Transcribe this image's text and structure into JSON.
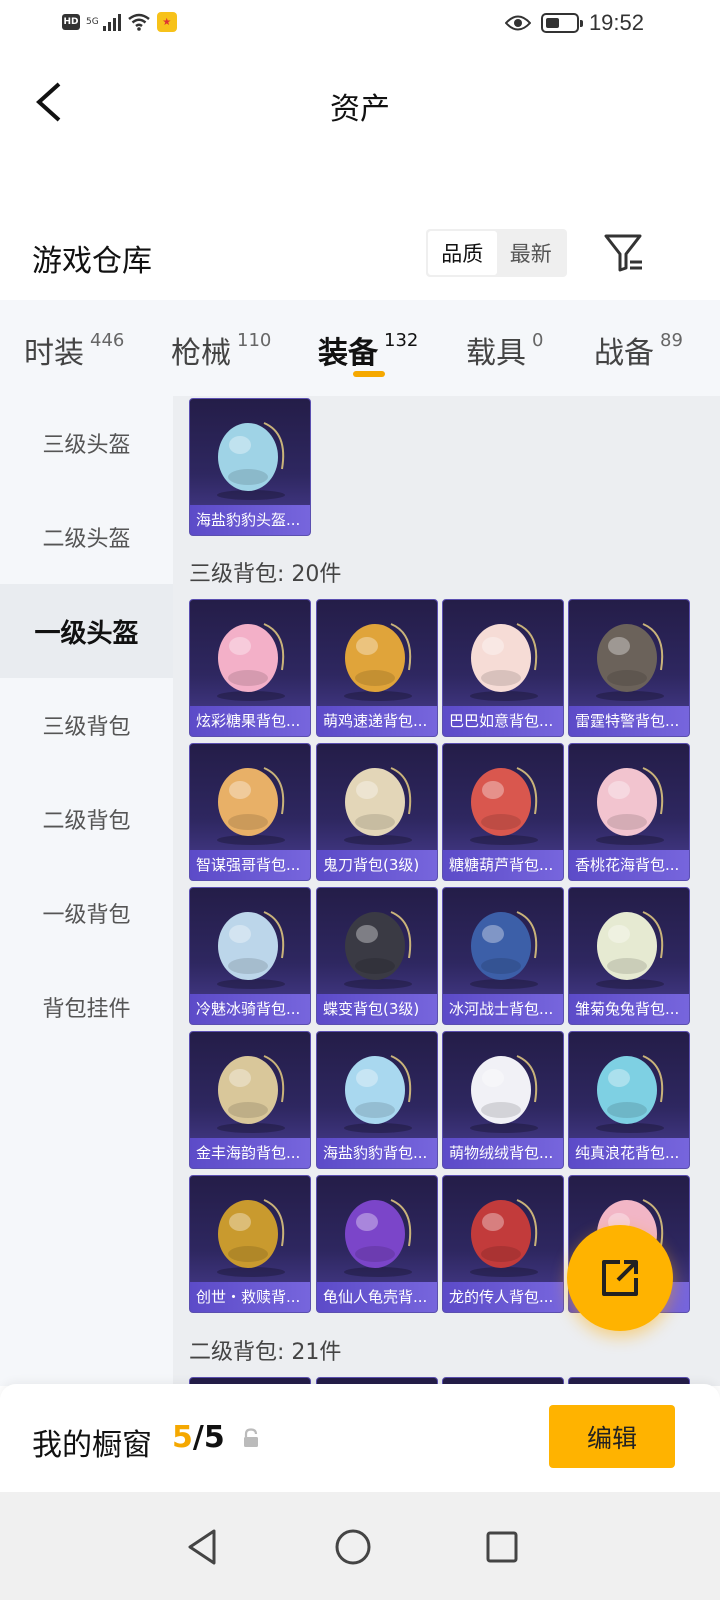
{
  "status_bar": {
    "hd": "HD",
    "network": "5G",
    "time": "19:52",
    "battery_level": 0.45
  },
  "header": {
    "title": "资产"
  },
  "warehouse": {
    "title": "游戏仓库",
    "sort_options": [
      "品质",
      "最新"
    ],
    "sort_selected": "品质"
  },
  "tabs": [
    {
      "label": "时装",
      "count": "446"
    },
    {
      "label": "枪械",
      "count": "110"
    },
    {
      "label": "装备",
      "count": "132"
    },
    {
      "label": "载具",
      "count": "0"
    },
    {
      "label": "战备",
      "count": "89"
    }
  ],
  "active_tab": "装备",
  "sidebar": {
    "items": [
      {
        "label": "三级头盔"
      },
      {
        "label": "二级头盔"
      },
      {
        "label": "一级头盔"
      },
      {
        "label": "三级背包"
      },
      {
        "label": "二级背包"
      },
      {
        "label": "一级背包"
      },
      {
        "label": "背包挂件"
      }
    ],
    "active": "一级头盔"
  },
  "content": {
    "helmet_items": [
      {
        "name": "海盐豹豹头盔...",
        "icon": "helmet-icon",
        "color": "#9fd3e6"
      }
    ],
    "sections": [
      {
        "label": "三级背包: 20件",
        "items": [
          {
            "name": "炫彩糖果背包...",
            "icon": "donut-backpack-icon",
            "color": "#f3b0c8"
          },
          {
            "name": "萌鸡速递背包...",
            "icon": "chick-backpack-icon",
            "color": "#e0a43a"
          },
          {
            "name": "巴巴如意背包...",
            "icon": "bunny-backpack-icon",
            "color": "#f6dcd6"
          },
          {
            "name": "雷霆特警背包...",
            "icon": "tactical-backpack-icon",
            "color": "#6b625a"
          },
          {
            "name": "智谋强哥背包...",
            "icon": "cake-backpack-icon",
            "color": "#e8b067"
          },
          {
            "name": "鬼刀背包(3级)",
            "icon": "blade-backpack-icon",
            "color": "#e3d6b8"
          },
          {
            "name": "糖糖葫芦背包...",
            "icon": "gourd-backpack-icon",
            "color": "#d9574e"
          },
          {
            "name": "香桃花海背包...",
            "icon": "peach-backpack-icon",
            "color": "#f2c4cf"
          },
          {
            "name": "冷魅冰骑背包...",
            "icon": "ice-backpack-icon",
            "color": "#bcd6ea"
          },
          {
            "name": "蝶变背包(3级)",
            "icon": "butterfly-backpack-icon",
            "color": "#3a3a44"
          },
          {
            "name": "冰河战士背包...",
            "icon": "warrior-backpack-icon",
            "color": "#3c5fa8"
          },
          {
            "name": "雏菊兔兔背包...",
            "icon": "daisy-backpack-icon",
            "color": "#e6ead2"
          },
          {
            "name": "金丰海韵背包...",
            "icon": "shell-backpack-icon",
            "color": "#d9c79a"
          },
          {
            "name": "海盐豹豹背包...",
            "icon": "seal-backpack-icon",
            "color": "#a9d8ef"
          },
          {
            "name": "萌物绒绒背包...",
            "icon": "plush-backpack-icon",
            "color": "#f1f1f6"
          },
          {
            "name": "纯真浪花背包...",
            "icon": "wave-backpack-icon",
            "color": "#7ed0e3"
          },
          {
            "name": "创世・救赎背...",
            "icon": "genesis-backpack-icon",
            "color": "#c99a2e"
          },
          {
            "name": "龟仙人龟壳背...",
            "icon": "turtle-backpack-icon",
            "color": "#7b45c9"
          },
          {
            "name": "龙的传人背包...",
            "icon": "dragon-backpack-icon",
            "color": "#c23b3b"
          },
          {
            "name": "",
            "icon": "pink-backpack-icon",
            "color": "#f2b6c6"
          }
        ]
      },
      {
        "label": "二级背包: 21件",
        "items": []
      }
    ]
  },
  "showcase": {
    "label": "我的橱窗",
    "current": "5",
    "total": "/5",
    "edit_label": "编辑"
  },
  "colors": {
    "accent": "#ffb300",
    "card_name_bg": "#6a5acd"
  }
}
